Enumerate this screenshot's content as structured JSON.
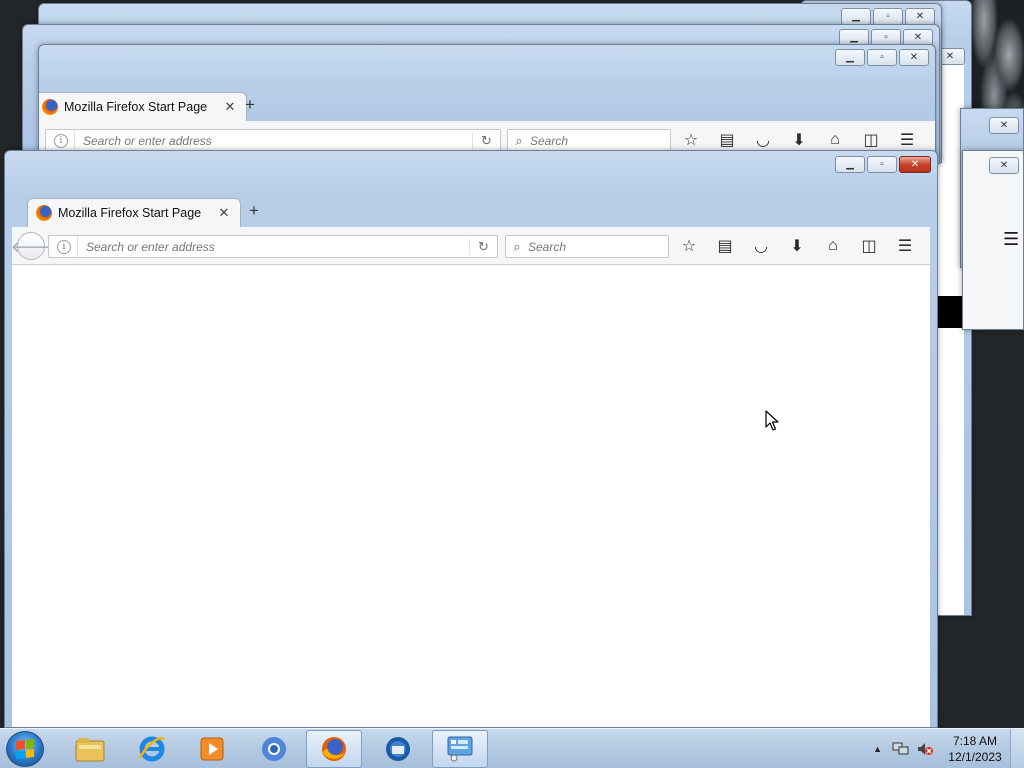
{
  "desktop": {
    "background_color": "#2a2e33"
  },
  "back_windows": [
    {
      "name": "background-window-1"
    },
    {
      "name": "background-window-2"
    },
    {
      "name": "background-window-3"
    }
  ],
  "window2": {
    "tab_title": "Mozilla Firefox Start Page",
    "url_placeholder": "Search or enter address",
    "search_placeholder": "Search"
  },
  "main_window": {
    "tab_title": "Mozilla Firefox Start Page",
    "new_tab_label": "+",
    "url_placeholder": "Search or enter address",
    "search_placeholder": "Search",
    "toolbar_icons": [
      "bookmark-star-icon",
      "reading-list-icon",
      "pocket-icon",
      "download-icon",
      "home-icon",
      "sidebar-icon",
      "menu-icon"
    ]
  },
  "taskbar": {
    "apps": [
      {
        "name": "file-explorer-icon"
      },
      {
        "name": "internet-explorer-icon"
      },
      {
        "name": "media-player-icon"
      },
      {
        "name": "chromium-icon"
      },
      {
        "name": "firefox-icon",
        "active": true
      },
      {
        "name": "thunderbird-icon"
      },
      {
        "name": "control-panel-icon",
        "active": true
      }
    ],
    "clock_time": "7:18 AM",
    "clock_date": "12/1/2023"
  },
  "colors": {
    "accent": "#a9c3e3",
    "close_red": "#c7432b"
  }
}
